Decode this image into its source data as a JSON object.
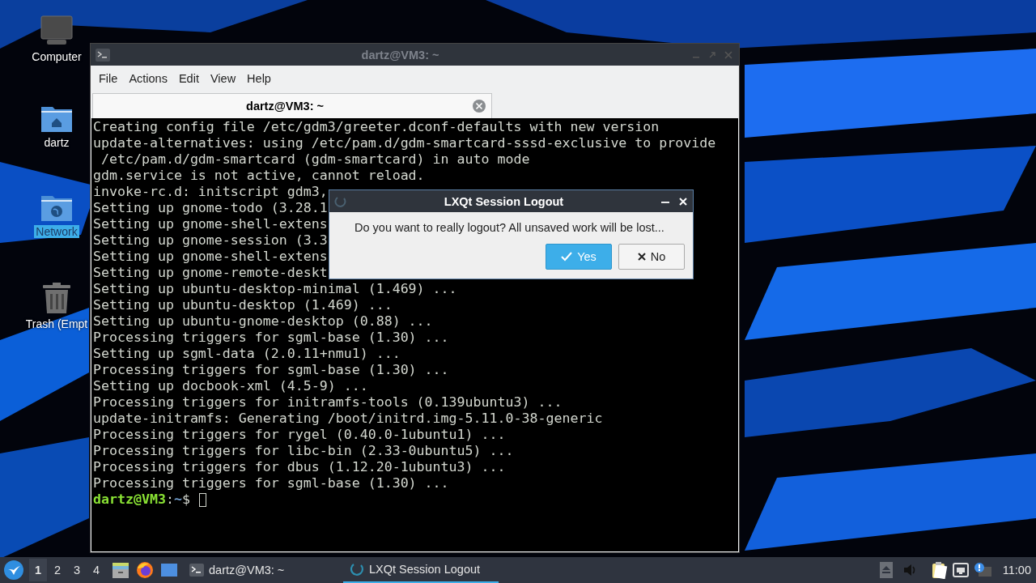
{
  "desktop_icons": [
    {
      "label": "Computer",
      "kind": "computer",
      "selected": false
    },
    {
      "label": "dartz",
      "kind": "home",
      "selected": false
    },
    {
      "label": "Network",
      "kind": "network",
      "selected": true
    },
    {
      "label": "Trash (Empt",
      "kind": "trash",
      "selected": false
    }
  ],
  "terminal": {
    "title": "dartz@VM3: ~",
    "focused": false,
    "menu": [
      "File",
      "Actions",
      "Edit",
      "View",
      "Help"
    ],
    "tabs": [
      {
        "label": "dartz@VM3: ~",
        "selected": true
      }
    ],
    "lines": [
      "Creating config file /etc/gdm3/greeter.dconf-defaults with new version",
      "update-alternatives: using /etc/pam.d/gdm-smartcard-sssd-exclusive to provide",
      " /etc/pam.d/gdm-smartcard (gdm-smartcard) in auto mode",
      "gdm.service is not active, cannot reload.",
      "invoke-rc.d: initscript gdm3,",
      "Setting up gnome-todo (3.28.1",
      "Setting up gnome-shell-extens",
      "Setting up gnome-session (3.3",
      "Setting up gnome-shell-extens",
      "Setting up gnome-remote-deskt",
      "Setting up ubuntu-desktop-minimal (1.469) ...",
      "Setting up ubuntu-desktop (1.469) ...",
      "Setting up ubuntu-gnome-desktop (0.88) ...",
      "Processing triggers for sgml-base (1.30) ...",
      "Setting up sgml-data (2.0.11+nmu1) ...",
      "Processing triggers for sgml-base (1.30) ...",
      "Setting up docbook-xml (4.5-9) ...",
      "Processing triggers for initramfs-tools (0.139ubuntu3) ...",
      "update-initramfs: Generating /boot/initrd.img-5.11.0-38-generic",
      "Processing triggers for rygel (0.40.0-1ubuntu1) ...",
      "Processing triggers for libc-bin (2.33-0ubuntu5) ...",
      "Processing triggers for dbus (1.12.20-1ubuntu3) ...",
      "Processing triggers for sgml-base (1.30) ..."
    ],
    "prompt": {
      "user_host": "dartz@VM3",
      "separator": ":",
      "path": "~",
      "symbol": "$"
    }
  },
  "dialog": {
    "title": "LXQt Session Logout",
    "message": "Do you want to really logout? All unsaved work will be lost...",
    "buttons": [
      {
        "label": "Yes",
        "kind": "confirm",
        "default": true
      },
      {
        "label": "No",
        "kind": "cancel",
        "default": false
      }
    ]
  },
  "taskbar": {
    "desktops": [
      {
        "label": "1",
        "selected": true
      },
      {
        "label": "2",
        "selected": false
      },
      {
        "label": "3",
        "selected": false
      },
      {
        "label": "4",
        "selected": false
      }
    ],
    "tasks": [
      {
        "label": "dartz@VM3: ~",
        "kind": "terminal",
        "selected": false
      },
      {
        "label": "LXQt Session Logout",
        "kind": "logout",
        "selected": true
      }
    ],
    "clock": "11:00"
  }
}
